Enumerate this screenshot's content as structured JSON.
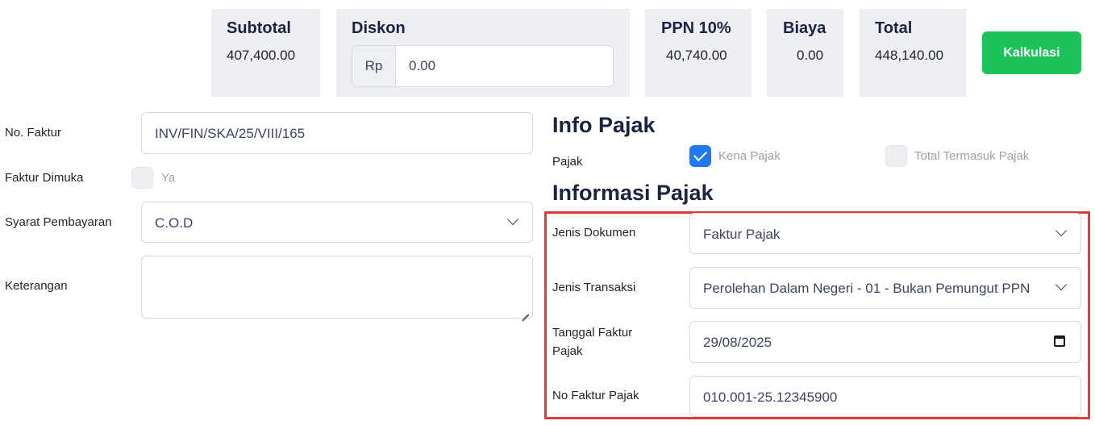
{
  "summary": {
    "subtotal": {
      "label": "Subtotal",
      "value": "407,400.00"
    },
    "diskon": {
      "label": "Diskon",
      "prefix": "Rp",
      "value": "0.00"
    },
    "ppn": {
      "label": "PPN 10%",
      "value": "40,740.00"
    },
    "biaya": {
      "label": "Biaya",
      "value": "0.00"
    },
    "total": {
      "label": "Total",
      "value": "448,140.00"
    },
    "kalkulasi_label": "Kalkulasi"
  },
  "form": {
    "no_faktur": {
      "label": "No. Faktur",
      "value": "INV/FIN/SKA/25/VIII/165"
    },
    "faktur_dimuka": {
      "label": "Faktur Dimuka",
      "option_label": "Ya",
      "checked": false
    },
    "syarat_pembayaran": {
      "label": "Syarat Pembayaran",
      "value": "C.O.D"
    },
    "keterangan": {
      "label": "Keterangan",
      "value": ""
    }
  },
  "info_pajak": {
    "title": "Info Pajak",
    "pajak_label": "Pajak",
    "kena_pajak": {
      "label": "Kena Pajak",
      "checked": true
    },
    "total_termasuk_pajak": {
      "label": "Total Termasuk Pajak",
      "checked": false
    }
  },
  "informasi_pajak": {
    "title": "Informasi Pajak",
    "jenis_dokumen": {
      "label": "Jenis Dokumen",
      "value": "Faktur Pajak"
    },
    "jenis_transaksi": {
      "label": "Jenis Transaksi",
      "value": "Perolehan Dalam Negeri - 01 - Bukan Pemungut PPN"
    },
    "tanggal_faktur_pajak": {
      "label_line1": "Tanggal Faktur",
      "label_line2": "Pajak",
      "value": "29/08/2025"
    },
    "no_faktur_pajak": {
      "label": "No Faktur Pajak",
      "value": "010.001-25.12345900"
    }
  },
  "colors": {
    "accent_green": "#1cc35a",
    "checkbox_blue": "#1f7af0",
    "highlight_red": "#e53935",
    "summary_bg": "#eeeff2"
  }
}
